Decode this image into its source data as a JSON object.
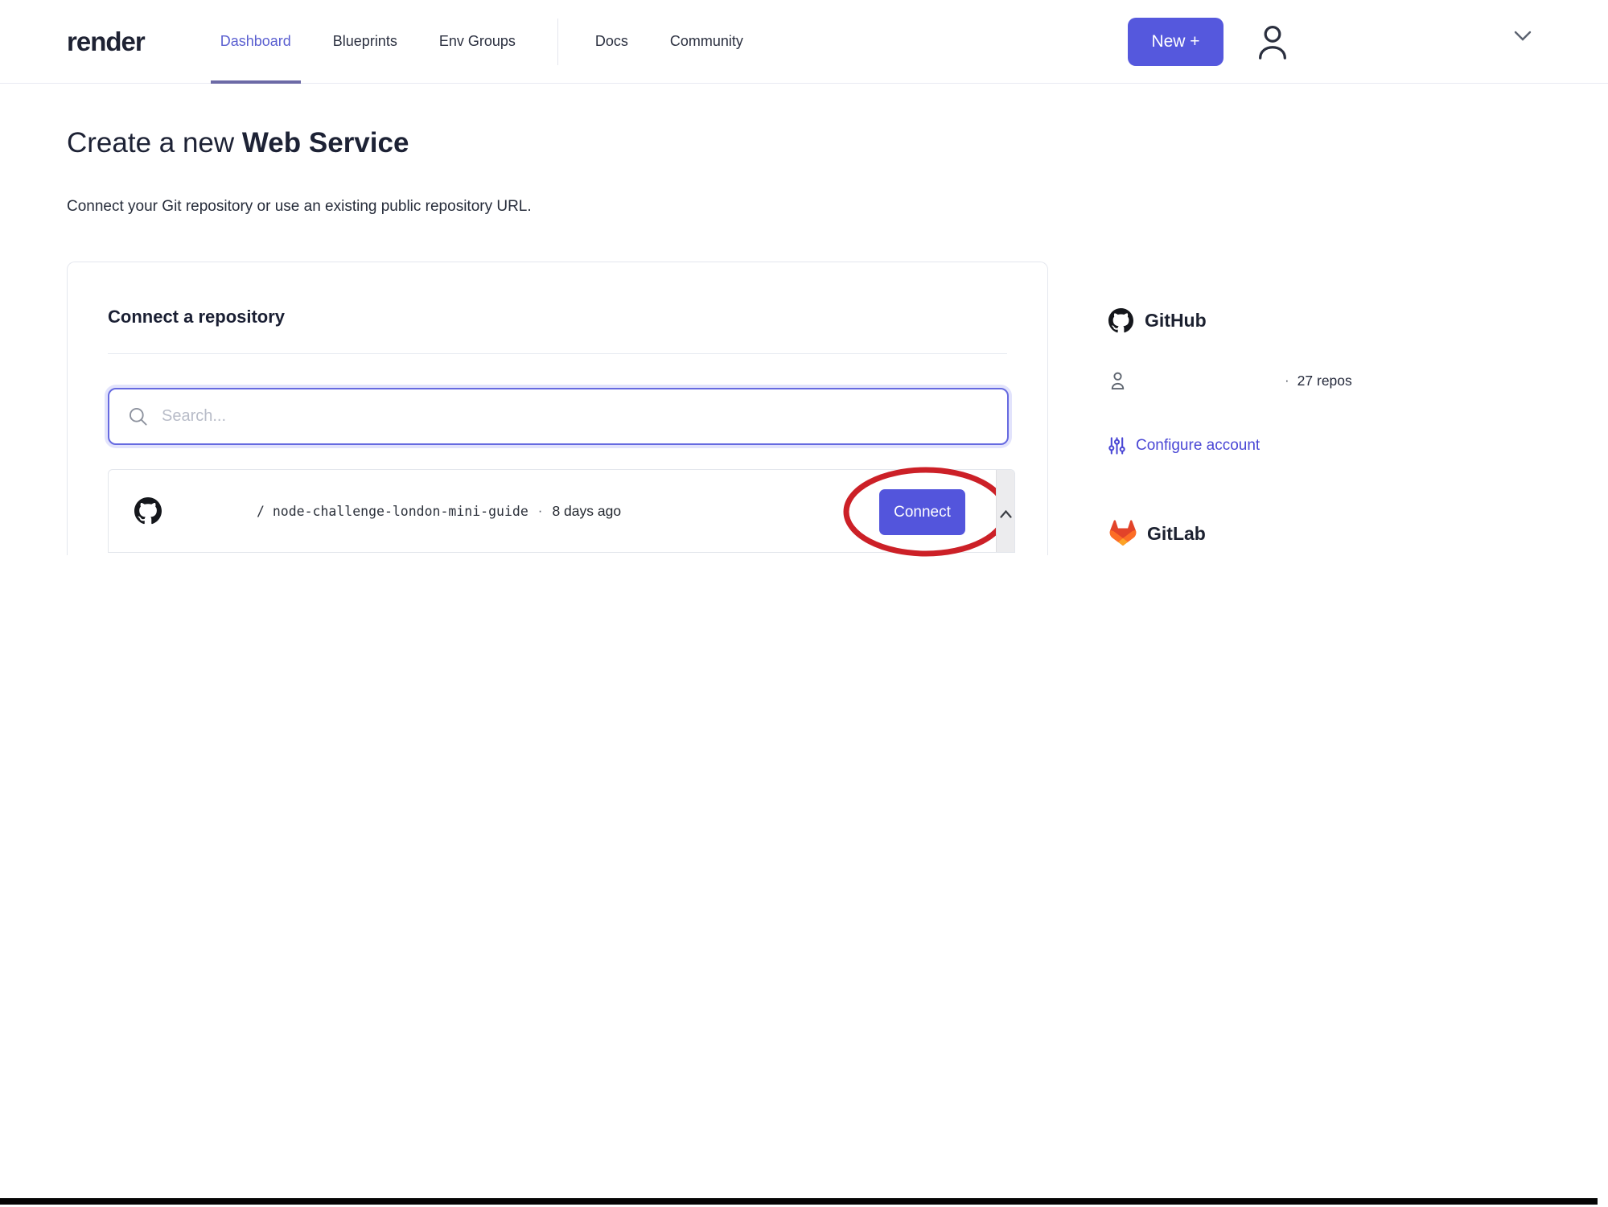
{
  "header": {
    "logo": "render",
    "nav": [
      {
        "label": "Dashboard",
        "active": true
      },
      {
        "label": "Blueprints",
        "active": false
      },
      {
        "label": "Env Groups",
        "active": false
      },
      {
        "label": "Docs",
        "active": false
      },
      {
        "label": "Community",
        "active": false
      }
    ],
    "new_button_label": "New +"
  },
  "page": {
    "title_prefix": "Create a new ",
    "title_emphasis": "Web Service",
    "subtitle": "Connect your Git repository or use an existing public repository URL."
  },
  "card": {
    "heading": "Connect a repository",
    "search_placeholder": "Search...",
    "repo": {
      "path": "/ node-challenge-london-mini-guide",
      "separator": "·",
      "updated": "8 days ago",
      "connect_label": "Connect"
    }
  },
  "sidebar": {
    "github": {
      "title": "GitHub",
      "separator": "·",
      "repos_count": "27 repos",
      "configure_label": "Configure account"
    },
    "gitlab": {
      "title": "GitLab"
    }
  },
  "colors": {
    "accent_indigo": "#5558dd",
    "active_nav": "#5a5fd0",
    "link_indigo": "#4a47d5",
    "annotation_red": "#cc2027",
    "gitlab_orange": "#fc6d26",
    "gitlab_red": "#e24329",
    "gitlab_yellow": "#fca326",
    "text_dark": "#1d2235",
    "bottom_bar": "#050505"
  }
}
